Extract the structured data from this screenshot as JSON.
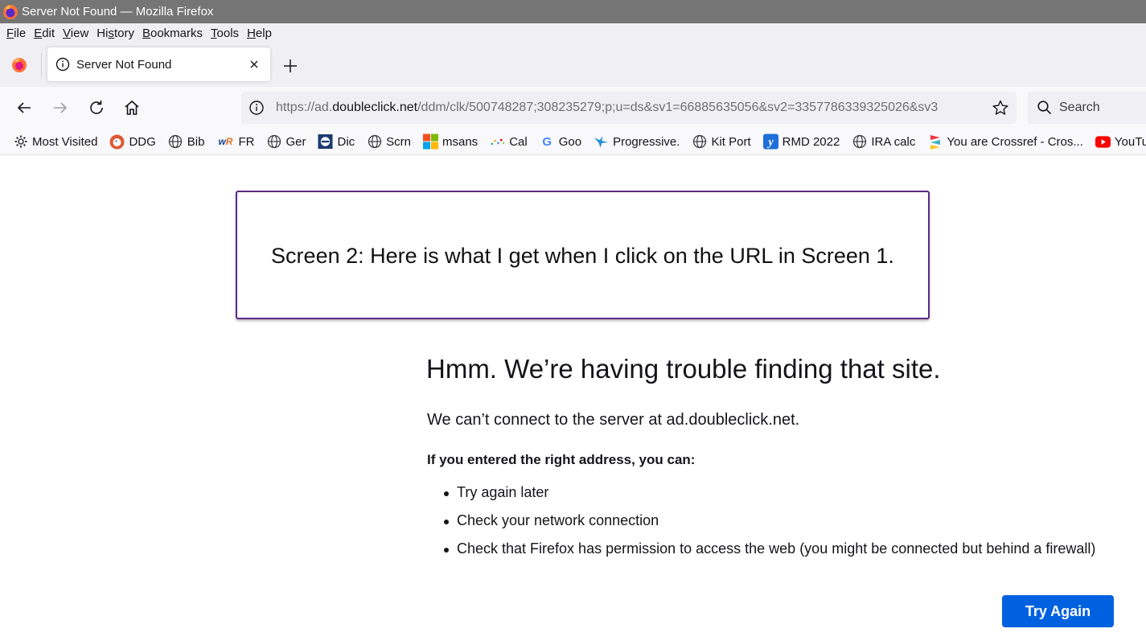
{
  "window": {
    "title": "Server Not Found — Mozilla Firefox"
  },
  "menu": [
    {
      "label": "File",
      "ul": "F",
      "rest": "ile"
    },
    {
      "label": "Edit",
      "ul": "E",
      "rest": "dit"
    },
    {
      "label": "View",
      "ul": "V",
      "rest": "iew"
    },
    {
      "label": "History",
      "pre": "Hi",
      "ul": "s",
      "rest": "tory"
    },
    {
      "label": "Bookmarks",
      "ul": "B",
      "rest": "ookmarks"
    },
    {
      "label": "Tools",
      "ul": "T",
      "rest": "ools"
    },
    {
      "label": "Help",
      "ul": "H",
      "rest": "elp"
    }
  ],
  "tab": {
    "title": "Server Not Found"
  },
  "urlbar": {
    "prefix": "https://ad.",
    "host": "doubleclick.net",
    "path": "/ddm/clk/500748287;308235279;p;u=ds&sv1=66885635056&sv2=3357786339325026&sv3"
  },
  "search": {
    "placeholder": "Search"
  },
  "bookmarks": [
    {
      "label": "Most Visited",
      "icon": "gear-icon"
    },
    {
      "label": "DDG",
      "icon": "duckduckgo-icon"
    },
    {
      "label": "Bib",
      "icon": "globe-icon"
    },
    {
      "label": "FR",
      "icon": "wordreference-icon"
    },
    {
      "label": "Ger",
      "icon": "globe-icon"
    },
    {
      "label": "Dic",
      "icon": "dictionary-icon"
    },
    {
      "label": "Scrn",
      "icon": "globe-icon"
    },
    {
      "label": "msans",
      "icon": "microsoft-icon"
    },
    {
      "label": "Cal",
      "icon": "calendar-icon"
    },
    {
      "label": "Goo",
      "icon": "google-icon"
    },
    {
      "label": "Progressive.",
      "icon": "progressive-icon"
    },
    {
      "label": "Kit Port",
      "icon": "globe-icon"
    },
    {
      "label": "RMD 2022",
      "icon": "yahoo-icon"
    },
    {
      "label": "IRA calc",
      "icon": "globe-icon"
    },
    {
      "label": "You are Crossref - Cros...",
      "icon": "crossref-icon"
    },
    {
      "label": "YouTube",
      "icon": "youtube-icon"
    }
  ],
  "annotation": {
    "text": "Screen 2: Here is what I get when I click on the URL in Screen 1."
  },
  "error": {
    "title": "Hmm. We’re having trouble finding that site.",
    "description": "We can’t connect to the server at ad.doubleclick.net.",
    "subheading": "If you entered the right address, you can:",
    "items": [
      "Try again later",
      "Check your network connection",
      "Check that Firefox has permission to access the web (you might be connected but behind a firewall)"
    ],
    "button": "Try Again"
  },
  "colors": {
    "titlebar": "#757575",
    "accent": "#0061e0",
    "annotation_border": "#5b2b82"
  }
}
